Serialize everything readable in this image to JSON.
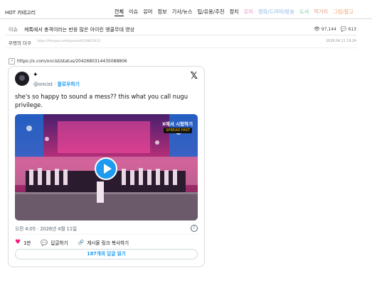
{
  "nav": {
    "title": "HOT 카테고리",
    "items": [
      {
        "label": "전체",
        "color": "#000000",
        "active": true
      },
      {
        "label": "이슈",
        "color": "#222222"
      },
      {
        "label": "유머",
        "color": "#222222"
      },
      {
        "label": "정보",
        "color": "#222222"
      },
      {
        "label": "기사/뉴스",
        "color": "#222222"
      },
      {
        "label": "팁/유용/추천",
        "color": "#222222"
      },
      {
        "label": "정치",
        "color": "#222222"
      },
      {
        "label": "유머",
        "color": "#e996c8"
      },
      {
        "label": "영화/드라마/방송",
        "color": "#8fb7e8"
      },
      {
        "label": "도서",
        "color": "#7dc7a7"
      },
      {
        "label": "먹거리",
        "color": "#e59a7c"
      },
      {
        "label": "그림/팝고",
        "color": "#f0a76e"
      }
    ]
  },
  "post": {
    "category": "이슈",
    "title": "케톡에서 충격이라는 반응 많은 아이린 앵콜무대 영상",
    "views": "97,144",
    "comments": "613",
    "author": "무명의 더쿠",
    "url": "https://theqoo.net/square/4159821612",
    "date": "2026.04.11 19:24",
    "link": "https://x.com/oncist/status/2042680314435088806"
  },
  "tweet": {
    "handle": "@oncist",
    "follow": "팔로우하기",
    "text": "she's so happy to sound a mess?? this what you call nugu privilege.",
    "watch_on_x": "X에서 시청하기",
    "program_logo": "SPREAD FAST",
    "timestamp": "오전 4:05 · 2026년 4월 11일",
    "likes": "1만",
    "reply_label": "답글하기",
    "copy_link": "게시물 링크 복사하기",
    "read_replies": "187개의 답글 읽기"
  },
  "icons": {
    "x_logo": "x-logo-icon",
    "play": "play-icon",
    "heart": "heart-icon",
    "reply": "reply-icon",
    "link": "link-icon",
    "info": "info-icon",
    "views": "eye-icon",
    "comments": "comment-icon"
  }
}
